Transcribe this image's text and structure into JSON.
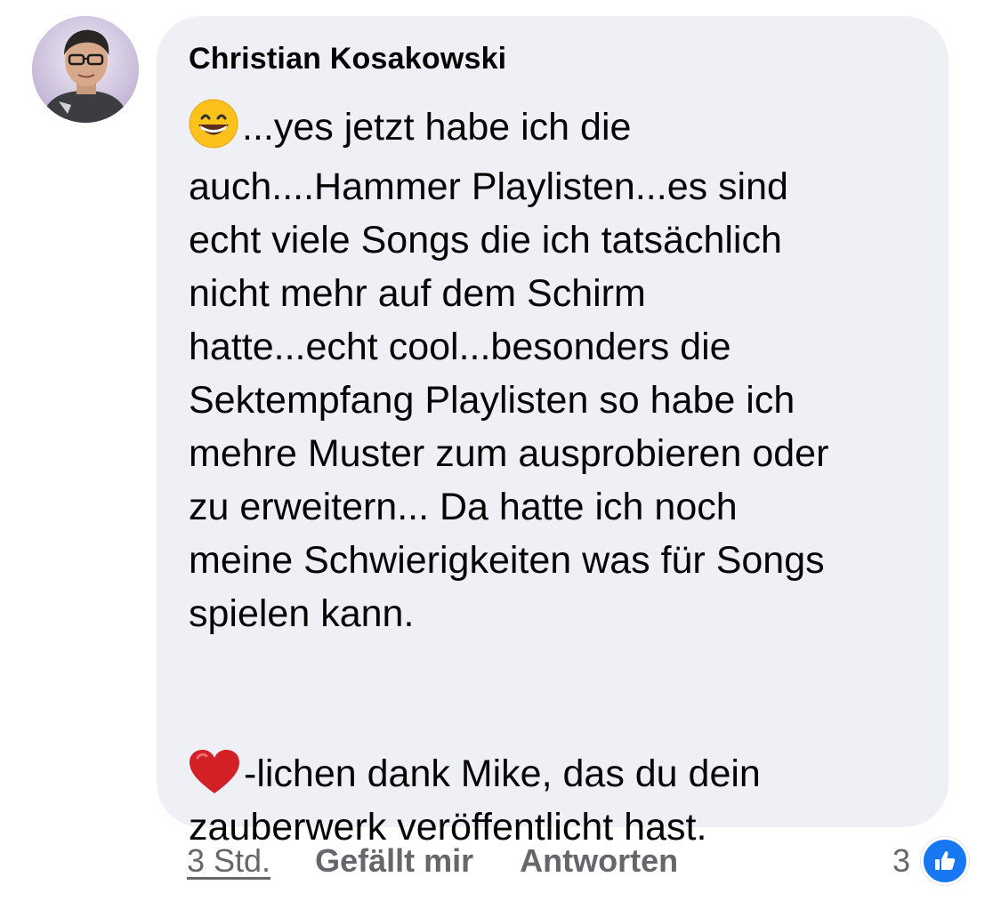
{
  "comment": {
    "author": "Christian Kosakowski",
    "lines": [
      "...yes jetzt habe ich die",
      "auch....Hammer Playlisten...es sind",
      "echt viele Songs die ich tatsächlich",
      "nicht mehr auf dem Schirm",
      "hatte...echt cool...besonders die",
      "Sektempfang Playlisten so habe ich",
      "mehre Muster zum ausprobieren oder",
      "zu erweitern... Da hatte ich noch",
      "meine Schwierigkeiten was für Songs",
      "spielen kann.",
      "-lichen dank Mike, das du dein",
      "zauberwerk veröffentlicht hast."
    ],
    "emojis": {
      "first": "grinning-face-emoji",
      "second": "red-heart-emoji"
    }
  },
  "actions": {
    "time": "3 Std.",
    "like": "Gefällt mir",
    "reply": "Antworten"
  },
  "reactions": {
    "count": "3",
    "icon": "thumbs-up-icon",
    "color": "#1877f2"
  },
  "colors": {
    "bubble": "#eff0f5",
    "secondary_text": "#65676b"
  }
}
